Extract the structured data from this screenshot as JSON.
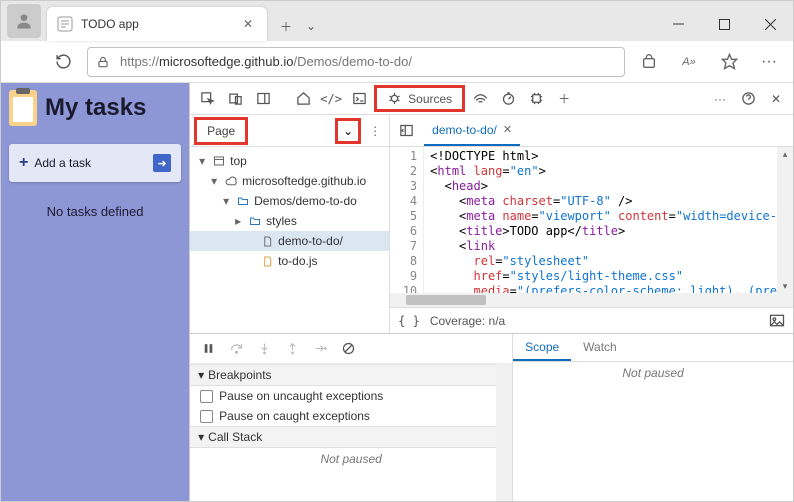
{
  "browser": {
    "tab_title": "TODO app",
    "url_prefix": "https://",
    "url_host": "microsoftedge.github.io",
    "url_path": "/Demos/demo-to-do/"
  },
  "app": {
    "title": "My tasks",
    "add_task": "Add a task",
    "empty": "No tasks defined"
  },
  "devtools": {
    "sources_label": "Sources",
    "page_tab": "Page",
    "tree": {
      "top": "top",
      "domain": "microsoftedge.github.io",
      "folder": "Demos/demo-to-do",
      "styles": "styles",
      "file_html": "demo-to-do/",
      "file_js": "to-do.js"
    },
    "open_file": "demo-to-do/",
    "gutter": [
      "1",
      "2",
      "3",
      "4",
      "5",
      "6",
      "7",
      "8",
      "9",
      "10"
    ],
    "status": {
      "brace": "{ }",
      "coverage": "Coverage: n/a"
    },
    "breakpoints": {
      "title": "Breakpoints",
      "uncaught": "Pause on uncaught exceptions",
      "caught": "Pause on caught exceptions"
    },
    "callstack": {
      "title": "Call Stack",
      "not_paused": "Not paused"
    },
    "scope": {
      "scope": "Scope",
      "watch": "Watch",
      "not_paused": "Not paused"
    }
  }
}
